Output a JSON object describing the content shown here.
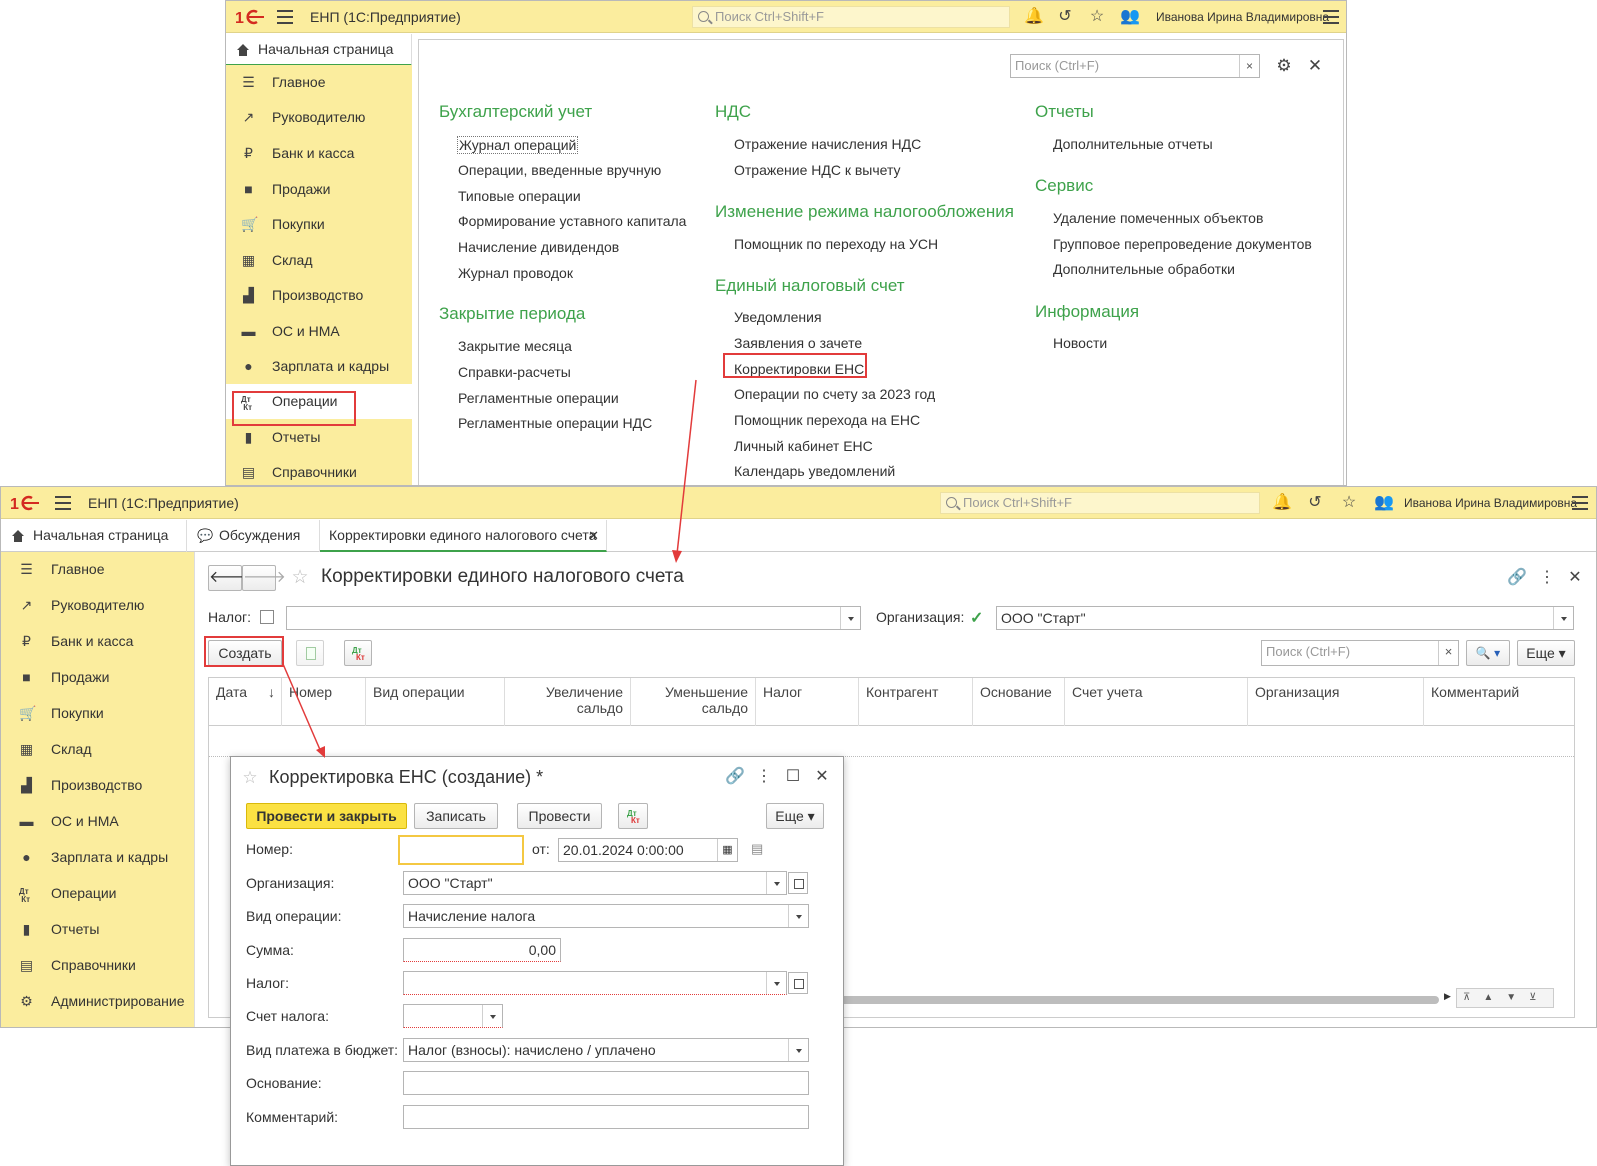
{
  "app": {
    "title": "ЕНП  (1С:Предприятие)",
    "search_placeholder": "Поиск Ctrl+Shift+F",
    "user": "Иванова Ирина Владимировна"
  },
  "sidebar": {
    "items": [
      {
        "label": "Главное",
        "icon": "list-icon"
      },
      {
        "label": "Руководителю",
        "icon": "chart-up-icon"
      },
      {
        "label": "Банк и касса",
        "icon": "ruble-icon"
      },
      {
        "label": "Продажи",
        "icon": "bag-icon"
      },
      {
        "label": "Покупки",
        "icon": "cart-icon"
      },
      {
        "label": "Склад",
        "icon": "grid-icon"
      },
      {
        "label": "Производство",
        "icon": "factory-icon"
      },
      {
        "label": "ОС и НМА",
        "icon": "truck-icon"
      },
      {
        "label": "Зарплата и кадры",
        "icon": "person-icon"
      },
      {
        "label": "Операции",
        "icon": "dtkt-icon"
      },
      {
        "label": "Отчеты",
        "icon": "bar-chart-icon"
      },
      {
        "label": "Справочники",
        "icon": "book-icon"
      },
      {
        "label": "Администрирование",
        "icon": "gear-icon"
      }
    ]
  },
  "back": {
    "tab_home": "Начальная страница",
    "search_placeholder": "Поиск (Ctrl+F)",
    "sections": [
      {
        "title": "Бухгалтерский учет",
        "items": [
          "Журнал операций",
          "Операции, введенные вручную",
          "Типовые операции",
          "Формирование уставного капитала",
          "Начисление дивидендов",
          "Журнал проводок"
        ]
      },
      {
        "title": "Закрытие периода",
        "items": [
          "Закрытие месяца",
          "Справки-расчеты",
          "Регламентные операции",
          "Регламентные операции НДС"
        ]
      },
      {
        "title": "НДС",
        "items": [
          "Отражение начисления НДС",
          "Отражение НДС к вычету"
        ]
      },
      {
        "title": "Изменение режима налогообложения",
        "items": [
          "Помощник по переходу на УСН"
        ]
      },
      {
        "title": "Единый налоговый счет",
        "items": [
          "Уведомления",
          "Заявления о зачете",
          "Корректировки ЕНС",
          "Операции по счету за 2023 год",
          "Помощник перехода на ЕНС",
          "Личный кабинет ЕНС",
          "Календарь уведомлений"
        ]
      },
      {
        "title": "Отчеты",
        "items": [
          "Дополнительные отчеты"
        ]
      },
      {
        "title": "Сервис",
        "items": [
          "Удаление помеченных объектов",
          "Групповое перепроведение документов",
          "Дополнительные обработки"
        ]
      },
      {
        "title": "Информация",
        "items": [
          "Новости"
        ]
      }
    ]
  },
  "front": {
    "tabs": [
      "Начальная страница",
      "Обсуждения",
      "Корректировки единого налогового счета"
    ],
    "title": "Корректировки единого налогового счета",
    "nalog_label": "Налог:",
    "org_label": "Организация:",
    "org_value": "ООО \"Старт\"",
    "create_label": "Создать",
    "search_placeholder": "Поиск (Ctrl+F)",
    "more_label": "Еще",
    "columns": [
      "Дата",
      "Номер",
      "Вид операции",
      "Увеличение сальдо",
      "Уменьшение сальдо",
      "Налог",
      "Контрагент",
      "Основание",
      "Счет учета",
      "Организация",
      "Комментарий"
    ]
  },
  "dialog": {
    "title": "Корректировка ЕНС (создание) *",
    "post_close": "Провести и закрыть",
    "write": "Записать",
    "post": "Провести",
    "more": "Еще",
    "labels": {
      "number": "Номер:",
      "from": "от:",
      "org": "Организация:",
      "op_kind": "Вид операции:",
      "sum": "Сумма:",
      "tax": "Налог:",
      "tax_account": "Счет налога:",
      "payment_kind": "Вид платежа в бюджет:",
      "basis": "Основание:",
      "comment": "Комментарий:"
    },
    "values": {
      "date": "20.01.2024  0:00:00",
      "org": "ООО \"Старт\"",
      "op_kind": "Начисление налога",
      "sum": "0,00",
      "payment_kind": "Налог (взносы): начислено / уплачено"
    }
  },
  "colors": {
    "accent_green": "#3ea24b",
    "header_yellow": "#fbed9e",
    "highlight_red": "#e23b3b",
    "button_yellow": "#fbe143"
  }
}
